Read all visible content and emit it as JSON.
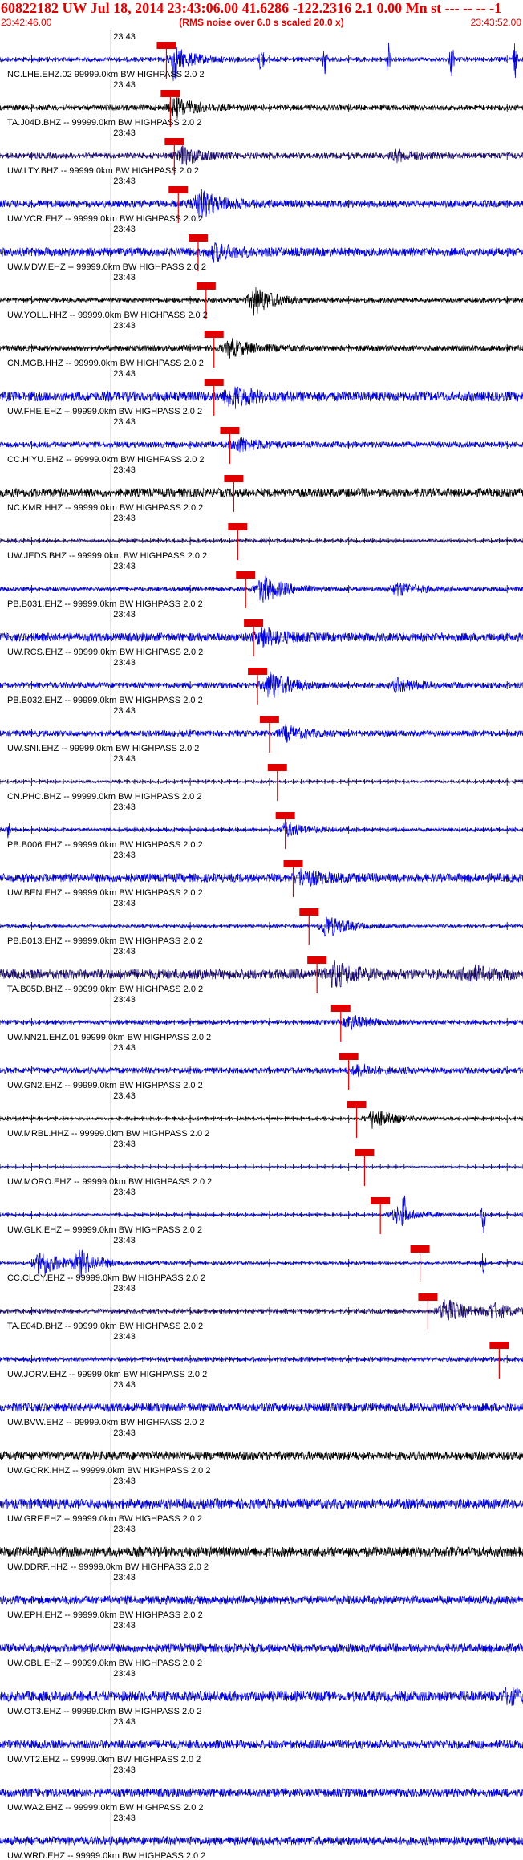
{
  "header": {
    "title": "60822182 UW Jul 18, 2014 23:43:06.00   41.6286 -122.2316  2.1 0.00 Mn st --- -- -- -1",
    "start_time": "23:42:46.00",
    "note": "(RMS noise over 6.0 s scaled 20.0 x)",
    "end_time": "23:43:52.00"
  },
  "colors": {
    "trace_blue": "#0000e0",
    "trace_dark_blue": "#1a0a70",
    "trace_black": "#000000",
    "pick_red": "#e00000",
    "grid": "#000000"
  },
  "chart_data": {
    "type": "line",
    "time_window": [
      "23:42:46.00",
      "23:43:52.00"
    ],
    "minute_tick_label": "23:43",
    "minute_tick_time": "23:43:00",
    "traces": [
      {
        "label": "NC.LHE.EHZ.02 99999.0km BW  HIGHPASS  2.0  2",
        "color": "blue",
        "pick": "23:43:07.0",
        "bursts": [
          {
            "t": "23:43:08",
            "amp": 0.8
          }
        ],
        "noise": 0.15,
        "spikes": [
          {
            "t": "23:43:08",
            "amp": 1.0
          },
          {
            "t": "23:43:19",
            "amp": 1.0
          },
          {
            "t": "23:43:27",
            "amp": 1.0
          },
          {
            "t": "23:43:35",
            "amp": 1.0
          },
          {
            "t": "23:43:43",
            "amp": 1.0
          },
          {
            "t": "23:43:51",
            "amp": 1.0
          }
        ]
      },
      {
        "label": "TA.J04D.BHZ -- 99999.0km BW  HIGHPASS  2.0  2",
        "color": "black",
        "pick": "23:43:07.5",
        "bursts": [
          {
            "t": "23:43:08",
            "amp": 0.7
          }
        ],
        "noise": 0.18,
        "spikes": []
      },
      {
        "label": "UW.LTY.BHZ -- 99999.0km BW  HIGHPASS  2.0  2",
        "color": "darkblue",
        "pick": "23:43:08.0",
        "bursts": [
          {
            "t": "23:43:09",
            "amp": 0.6
          },
          {
            "t": "23:43:36",
            "amp": 0.35
          }
        ],
        "noise": 0.2,
        "spikes": []
      },
      {
        "label": "UW.VCR.EHZ -- 99999.0km BW  HIGHPASS  2.0  2",
        "color": "blue",
        "pick": "23:43:08.5",
        "bursts": [
          {
            "t": "23:43:11",
            "amp": 1.0
          }
        ],
        "noise": 0.25,
        "spikes": []
      },
      {
        "label": "UW.MDW.EHZ -- 99999.0km BW  HIGHPASS  2.0  2",
        "color": "blue",
        "pick": "23:43:11.0",
        "bursts": [
          {
            "t": "23:43:13",
            "amp": 0.5
          }
        ],
        "noise": 0.3,
        "spikes": []
      },
      {
        "label": "UW.YOLL.HHZ -- 99999.0km BW  HIGHPASS  2.0  2",
        "color": "black",
        "pick": "23:43:12.0",
        "bursts": [
          {
            "t": "23:43:18",
            "amp": 1.0
          }
        ],
        "noise": 0.15,
        "spikes": []
      },
      {
        "label": "CN.MGB.HHZ -- 99999.0km BW  HIGHPASS  2.0  2",
        "color": "black",
        "pick": "23:43:13.0",
        "bursts": [
          {
            "t": "23:43:15",
            "amp": 0.6
          }
        ],
        "noise": 0.2,
        "spikes": []
      },
      {
        "label": "UW.FHE.EHZ -- 99999.0km BW  HIGHPASS  2.0  2",
        "color": "blue",
        "pick": "23:43:13.0",
        "bursts": [
          {
            "t": "23:43:15",
            "amp": 0.7
          }
        ],
        "noise": 0.35,
        "spikes": []
      },
      {
        "label": "CC.HIYU.EHZ -- 99999.0km BW  HIGHPASS  2.0  2",
        "color": "blue",
        "pick": "23:43:15.0",
        "bursts": [
          {
            "t": "23:43:16",
            "amp": 0.5
          }
        ],
        "noise": 0.2,
        "spikes": []
      },
      {
        "label": "NC.KMR.HHZ -- 99999.0km BW  HIGHPASS  2.0  2",
        "color": "black",
        "pick": "23:43:15.5",
        "bursts": [],
        "noise": 0.3,
        "spikes": []
      },
      {
        "label": "UW.JEDS.BHZ -- 99999.0km BW  HIGHPASS  2.0  2",
        "color": "darkblue",
        "pick": "23:43:16.0",
        "bursts": [],
        "noise": 0.12,
        "spikes": []
      },
      {
        "label": "PB.B031.EHZ -- 99999.0km BW  HIGHPASS  2.0  2",
        "color": "blue",
        "pick": "23:43:17.0",
        "bursts": [
          {
            "t": "23:43:19",
            "amp": 1.0
          },
          {
            "t": "23:43:36",
            "amp": 0.5
          }
        ],
        "noise": 0.15,
        "spikes": []
      },
      {
        "label": "UW.RCS.EHZ -- 99999.0km BW  HIGHPASS  2.0  2",
        "color": "blue",
        "pick": "23:43:18.0",
        "bursts": [
          {
            "t": "23:43:19",
            "amp": 0.6
          }
        ],
        "noise": 0.3,
        "spikes": []
      },
      {
        "label": "PB.B032.EHZ -- 99999.0km BW  HIGHPASS  2.0  2",
        "color": "blue",
        "pick": "23:43:18.5",
        "bursts": [
          {
            "t": "23:43:20",
            "amp": 1.0
          },
          {
            "t": "23:43:36",
            "amp": 0.4
          }
        ],
        "noise": 0.2,
        "spikes": []
      },
      {
        "label": "UW.SNI.EHZ -- 99999.0km BW  HIGHPASS  2.0  2",
        "color": "blue",
        "pick": "23:43:20.0",
        "bursts": [
          {
            "t": "23:43:22",
            "amp": 0.5
          }
        ],
        "noise": 0.2,
        "spikes": []
      },
      {
        "label": "CN.PHC.BHZ -- 99999.0km BW  HIGHPASS  2.0  2",
        "color": "darkblue",
        "pick": "23:43:21.0",
        "bursts": [],
        "noise": 0.1,
        "spikes": []
      },
      {
        "label": "PB.B006.EHZ -- 99999.0km BW  HIGHPASS  2.0  2",
        "color": "blue",
        "pick": "23:43:22.0",
        "bursts": [
          {
            "t": "23:43:22",
            "amp": 0.5
          }
        ],
        "noise": 0.12,
        "spikes": [
          {
            "t": "23:42:47",
            "amp": 0.6
          }
        ]
      },
      {
        "label": "UW.BEN.EHZ -- 99999.0km BW  HIGHPASS  2.0  2",
        "color": "blue",
        "pick": "23:43:23.0",
        "bursts": [
          {
            "t": "23:43:24",
            "amp": 0.5
          }
        ],
        "noise": 0.3,
        "spikes": []
      },
      {
        "label": "PB.B013.EHZ -- 99999.0km BW  HIGHPASS  2.0  2",
        "color": "blue",
        "pick": "23:43:25.0",
        "bursts": [
          {
            "t": "23:43:27",
            "amp": 0.9
          }
        ],
        "noise": 0.1,
        "spikes": []
      },
      {
        "label": "TA.B05D.BHZ -- 99999.0km BW  HIGHPASS  2.0  2",
        "color": "darkblue",
        "pick": "23:43:26.0",
        "bursts": [
          {
            "t": "23:43:28",
            "amp": 0.8
          },
          {
            "t": "23:43:45",
            "amp": 0.5
          }
        ],
        "noise": 0.35,
        "spikes": []
      },
      {
        "label": "UW.NN21.EHZ.01 99999.0km BW  HIGHPASS  2.0  2",
        "color": "blue",
        "pick": "23:43:29.0",
        "bursts": [
          {
            "t": "23:43:30",
            "amp": 0.5
          }
        ],
        "noise": 0.15,
        "spikes": []
      },
      {
        "label": "UW.GN2.EHZ -- 99999.0km BW  HIGHPASS  2.0  2",
        "color": "blue",
        "pick": "23:43:30.0",
        "bursts": [
          {
            "t": "23:43:31",
            "amp": 0.4
          }
        ],
        "noise": 0.2,
        "spikes": []
      },
      {
        "label": "UW.MRBL.HHZ -- 99999.0km BW  HIGHPASS  2.0  2",
        "color": "black",
        "pick": "23:43:31.0",
        "bursts": [
          {
            "t": "23:43:33",
            "amp": 0.7
          }
        ],
        "noise": 0.1,
        "spikes": []
      },
      {
        "label": "UW.MORO.EHZ -- 99999.0km BW  HIGHPASS  2.0  2",
        "color": "blue",
        "pick": "23:43:32.0",
        "bursts": [],
        "noise": 0.05,
        "spikes": []
      },
      {
        "label": "UW.GLK.EHZ -- 99999.0km BW  HIGHPASS  2.0  2",
        "color": "blue",
        "pick": "23:43:34.0",
        "bursts": [
          {
            "t": "23:43:36",
            "amp": 0.6
          }
        ],
        "noise": 0.1,
        "spikes": [
          {
            "t": "23:43:37",
            "amp": 0.9
          },
          {
            "t": "23:43:47",
            "amp": 1.0
          }
        ]
      },
      {
        "label": "CC.CLCY.EHZ -- 99999.0km BW  HIGHPASS  2.0  2",
        "color": "blue",
        "pick": "23:43:39.0",
        "bursts": [
          {
            "t": "23:42:51",
            "amp": 1.0
          },
          {
            "t": "23:42:56",
            "amp": 0.8
          }
        ],
        "noise": 0.1,
        "spikes": [
          {
            "t": "23:43:47",
            "amp": 0.7
          }
        ]
      },
      {
        "label": "TA.E04D.BHZ -- 99999.0km BW  HIGHPASS  2.0  2",
        "color": "darkblue",
        "pick": "23:43:40.0",
        "bursts": [
          {
            "t": "23:43:42",
            "amp": 0.9
          },
          {
            "t": "23:43:48",
            "amp": 0.5
          }
        ],
        "noise": 0.15,
        "spikes": []
      },
      {
        "label": "UW.JORV.EHZ -- 99999.0km BW  HIGHPASS  2.0  2",
        "color": "blue",
        "pick": "23:43:49.0",
        "bursts": [],
        "noise": 0.15,
        "spikes": []
      },
      {
        "label": "UW.BVW.EHZ -- 99999.0km BW  HIGHPASS  2.0  2",
        "color": "blue",
        "pick": null,
        "bursts": [],
        "noise": 0.3,
        "spikes": []
      },
      {
        "label": "UW.GCRK.HHZ -- 99999.0km BW  HIGHPASS  2.0  2",
        "color": "black",
        "pick": null,
        "bursts": [],
        "noise": 0.3,
        "spikes": []
      },
      {
        "label": "UW.GRF.EHZ -- 99999.0km BW  HIGHPASS  2.0  2",
        "color": "blue",
        "pick": null,
        "bursts": [],
        "noise": 0.35,
        "spikes": []
      },
      {
        "label": "UW.DDRF.HHZ -- 99999.0km BW  HIGHPASS  2.0  2",
        "color": "black",
        "pick": null,
        "bursts": [],
        "noise": 0.35,
        "spikes": []
      },
      {
        "label": "UW.EPH.EHZ -- 99999.0km BW  HIGHPASS  2.0  2",
        "color": "blue",
        "pick": null,
        "bursts": [],
        "noise": 0.3,
        "spikes": []
      },
      {
        "label": "UW.GBL.EHZ -- 99999.0km BW  HIGHPASS  2.0  2",
        "color": "blue",
        "pick": null,
        "bursts": [],
        "noise": 0.3,
        "spikes": []
      },
      {
        "label": "UW.OT3.EHZ -- 99999.0km BW  HIGHPASS  2.0  2",
        "color": "blue",
        "pick": null,
        "bursts": [
          {
            "t": "23:43:50",
            "amp": 0.4
          }
        ],
        "noise": 0.35,
        "spikes": []
      },
      {
        "label": "UW.VT2.EHZ -- 99999.0km BW  HIGHPASS  2.0  2",
        "color": "blue",
        "pick": null,
        "bursts": [],
        "noise": 0.3,
        "spikes": []
      },
      {
        "label": "UW.WA2.EHZ -- 99999.0km BW  HIGHPASS  2.0  2",
        "color": "blue",
        "pick": null,
        "bursts": [],
        "noise": 0.3,
        "spikes": []
      },
      {
        "label": "UW.WRD.EHZ -- 99999.0km BW  HIGHPASS  2.0  2",
        "color": "blue",
        "pick": null,
        "bursts": [],
        "noise": 0.3,
        "spikes": []
      }
    ]
  }
}
